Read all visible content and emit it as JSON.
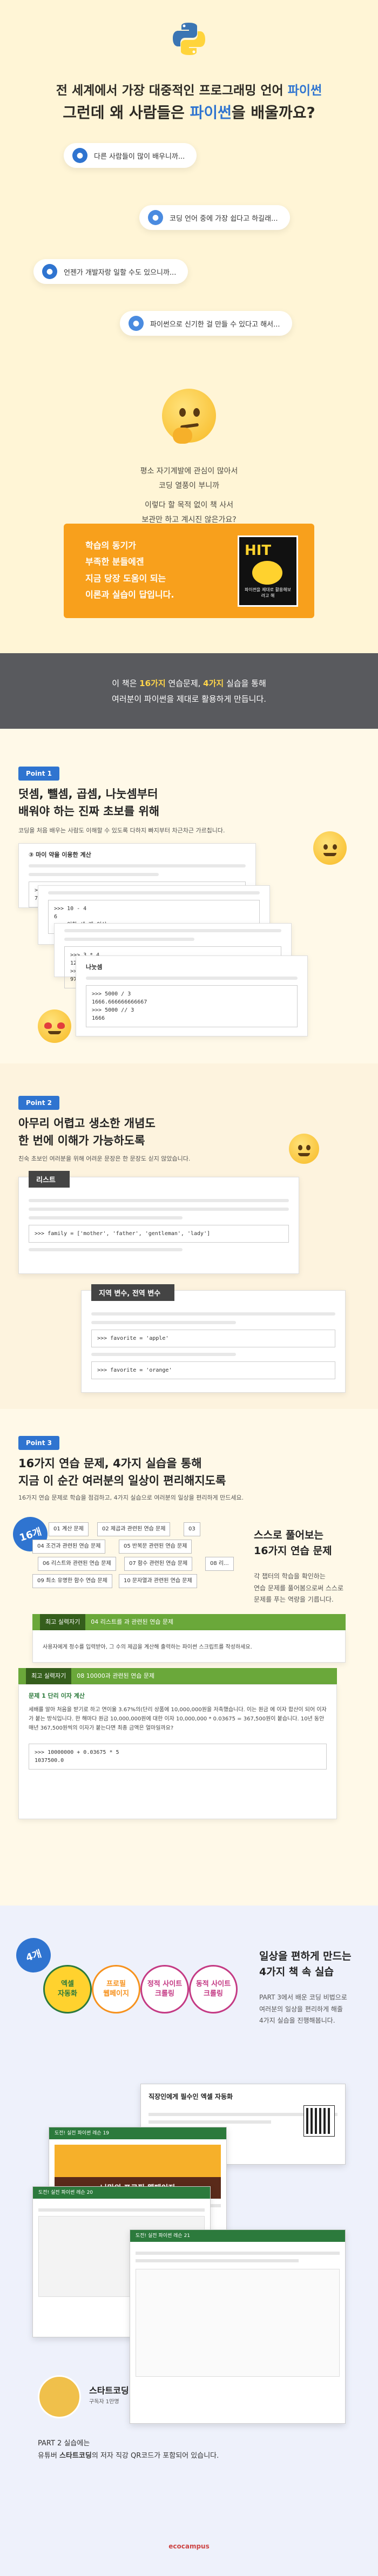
{
  "hero": {
    "title_line1_a": "전 세계에서 가장 대중적인 프로그래밍 언어 ",
    "title_line1_b": "파이썬",
    "title_line2_a": "그런데 왜 사람들은 ",
    "title_line2_b": "파이썬",
    "title_line2_c": "을 배울까요?",
    "bubbles": [
      "다른 사람들이 많이 배우니까...",
      "코딩 언어 중에 가장 쉽다고 하길래...",
      "언젠가 개발자랑 일할 수도 있으니까...",
      "파이썬으로 신기한 걸 만들 수 있다고 해서..."
    ],
    "muted_lines": [
      "평소 자기계발에 관심이 많아서",
      "코딩 열풍이 부니까",
      "",
      "이렇다 할 목적 없이 책 사서",
      "보관만 하고 계시진 않은가요?"
    ],
    "orange_lines": [
      "학습의 동기가",
      "부족한 분들에겐",
      "지금 당장 도움이 되는",
      "이론과 실습이 답입니다."
    ],
    "book": {
      "hit": "HIT",
      "text": "파이썬을 제대로 활용해보려고 해"
    }
  },
  "band": {
    "line1_a": "이 책은 ",
    "line1_b": "16가지",
    "line1_c": " 연습문제, ",
    "line1_d": "4가지",
    "line1_e": " 실습을 통해",
    "line2": "여러분이 파이썬을 제대로 활용하게 만듭니다."
  },
  "point1": {
    "tag": "Point 1",
    "title1": "덧셈, 뺄셈, 곱셈, 나눗셈부터",
    "title2": "배워야 하는 진짜 초보를 위해",
    "sub": "코딩을 처음 배우는 사람도 이해할 수 있도록 다하지 빠지부터 차근차근 가르칩니다.",
    "card1_head": "③ 마이 약을 이용한 계산",
    "card1_code": ">>> 3 + 4\n7",
    "card2_code": ">>> 10 - 4\n6\n>>> 이항 세 개 이상",
    "card3_code": ">>> 3 * 4\n12\n>>> 5 ** 10\n9765625",
    "card4_head": "나눗셈",
    "card4_code": ">>> 5000 / 3\n1666.666666666667\n>>> 5000 // 3\n1666"
  },
  "point2": {
    "tag": "Point 2",
    "title1": "아무리 어렵고 생소한 개념도",
    "title2": "한 번에 이해가 가능하도록",
    "sub": "친숙 초보인 여러분을 위해 어려운 문장은 한 문장도 싣지 않았습니다.",
    "card1_label": "리스트",
    "card1_code": ">>> family = ['mother', 'father', 'gentleman', 'lady']",
    "card2_label": "지역 변수, 전역 변수",
    "card2_code1": ">>> favorite = 'apple'",
    "card2_code2": ">>> favorite = 'orange'"
  },
  "point3": {
    "tag": "Point 3",
    "title1": "16가지 연습 문제, 4가지 실습을 통해",
    "title2": "지금 이 순간 여러분의 일상이 편리해지도록",
    "sub": "16가지 연습 문제로 학습을 점검하고, 4가지 실습으로 여러분의 일상을 편리하게 만드세요.",
    "badge": "16개",
    "topics": [
      "01 계산 문제",
      "02 제곱과 관련된 연습 문제",
      "03",
      "04 조건과 관련된 연습 문제",
      "05 반복문 관련된 연습 문제",
      "06 리스트와 관련된 연습 문제",
      "07 함수 관련된 연습 문제",
      "08 리...",
      "09 최소 유명한 함수 연습 문제",
      "10 문자열과 관련된 연습 문제"
    ],
    "side_title1": "스스로 풀어보는",
    "side_title2": "16가지 연습 문제",
    "side_text": [
      "각 챕터의 학습을 확인하는",
      "연습 문제를 풀어봄으로써 스스로",
      "문제를 푸는 역량을 기릅니다."
    ],
    "bar1_tag": "04 리스트를 과 관련된 연습 문제",
    "bar1": "최고 실력자기",
    "bar1_text": "사용자에게 정수를 입력받아, 그 수의 제곱을 계산해 출력하는 파이썬 스크립트를 작성하세요.",
    "bar2_tag": "08 10000과 관련된 연습 문제",
    "bar2": "최고 실력자기",
    "problem_title": "문제 1     단리 이자 계산",
    "problem_text": "세배를 알아 처음을 받기로 하고 연이율 3.67%의(단리 상품에 10,000,000원을 저축했습니다. 이는 원금 에 이자 합산이 되어 이자가 붙는 방식입니다. 한 해마다 원금 10,000,000원에 대한 이자 10,000,000 * 0.03675 = 367,500원이 붙습니다. 10년 동안 매년 367,500원씩의 이자가 붙는다면 최종 금액은 얼마일까요?",
    "code": ">>> 10000000 + 0.03675 * 5\n1037500.0"
  },
  "point4": {
    "badge": "4개",
    "features": [
      "엑셀\n자동화",
      "프로필\n웹페이지",
      "정적 사이트\n크롤링",
      "동적 사이트\n크롤링"
    ],
    "side_title1": "일상을 편하게 만드는",
    "side_title2": "4가지 책 속 실습",
    "side_text": [
      "PART 3에서 배운 코딩 비법으로",
      "여러분의 일상을 편리하게 해줄",
      "4가지 실습을 진행해봅니다."
    ],
    "shot1_title": "직장인에게 필수인 엑셀 자동화",
    "shot2_bar": "도전! 실전 파이썬 레슨 19",
    "shot2_heading": "나만의 프로필 웹페이지",
    "shot3_bar": "도전! 실전 파이썬 레슨 20",
    "shot4_bar": "도전! 실전 파이썬 레슨 21",
    "author_name": "스타트코딩",
    "author_sub": "구독자 1만명",
    "bottom_text1": "PART 2 실습에는",
    "bottom_text2_a": "유튜버 ",
    "bottom_text2_b": "스타트코딩",
    "bottom_text2_c": "의 저자 직강 QR코드가 포함되어 있습니다.",
    "footer": "ecocampus"
  }
}
